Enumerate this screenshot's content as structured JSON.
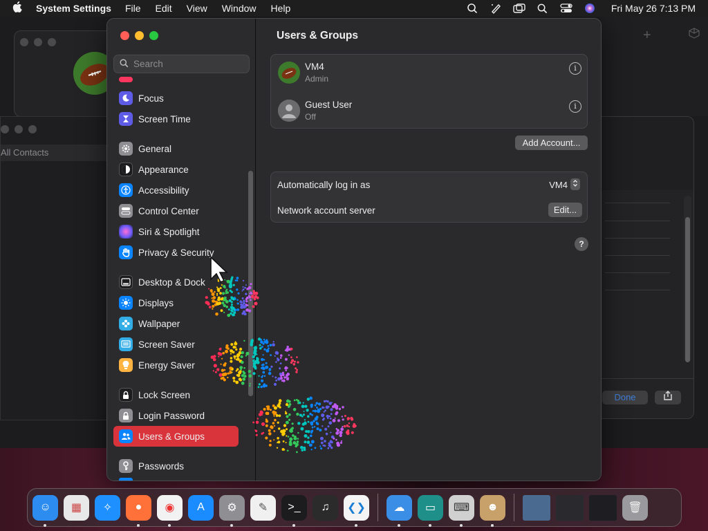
{
  "menubar": {
    "app_name": "System Settings",
    "menus": [
      "File",
      "Edit",
      "View",
      "Window",
      "Help"
    ],
    "clock": "Fri May 26  7:13 PM"
  },
  "bg_windows": {
    "contacts_label": "All Contacts",
    "done_label": "Done"
  },
  "sidebar": {
    "search_placeholder": "Search",
    "items": [
      {
        "label": "Focus",
        "icon": "moon-icon",
        "color": "#5e5ce6"
      },
      {
        "label": "Screen Time",
        "icon": "hourglass-icon",
        "color": "#5e5ce6"
      },
      {
        "label": "General",
        "icon": "gear-icon",
        "color": "#8e8e93"
      },
      {
        "label": "Appearance",
        "icon": "appearance-icon",
        "color": "#1c1c1e"
      },
      {
        "label": "Accessibility",
        "icon": "accessibility-icon",
        "color": "#0a84ff"
      },
      {
        "label": "Control Center",
        "icon": "control-center-icon",
        "color": "#8e8e93"
      },
      {
        "label": "Siri & Spotlight",
        "icon": "siri-icon",
        "color": "#bf5af2"
      },
      {
        "label": "Privacy & Security",
        "icon": "hand-icon",
        "color": "#0a84ff"
      },
      {
        "label": "Desktop & Dock",
        "icon": "dock-icon",
        "color": "#1c1c1e"
      },
      {
        "label": "Displays",
        "icon": "sun-icon",
        "color": "#0a84ff"
      },
      {
        "label": "Wallpaper",
        "icon": "flower-icon",
        "color": "#32ade6"
      },
      {
        "label": "Screen Saver",
        "icon": "screen-saver-icon",
        "color": "#32ade6"
      },
      {
        "label": "Energy Saver",
        "icon": "bulb-icon",
        "color": "#ffb340"
      },
      {
        "label": "Lock Screen",
        "icon": "lock-icon",
        "color": "#1c1c1e"
      },
      {
        "label": "Login Password",
        "icon": "lock-icon",
        "color": "#8e8e93"
      },
      {
        "label": "Users & Groups",
        "icon": "users-icon",
        "color": "#0a84ff"
      },
      {
        "label": "Passwords",
        "icon": "key-icon",
        "color": "#8e8e93"
      }
    ],
    "selected": "Users & Groups"
  },
  "content": {
    "title": "Users & Groups",
    "users": [
      {
        "name": "VM4",
        "role": "Admin"
      },
      {
        "name": "Guest User",
        "role": "Off"
      }
    ],
    "add_account_label": "Add Account...",
    "auto_login_label": "Automatically log in as",
    "auto_login_value": "VM4",
    "network_server_label": "Network account server",
    "edit_label": "Edit...",
    "help_label": "?"
  },
  "colors": {
    "accent_selected": "#d9343c",
    "window_bg": "#29292b"
  },
  "dock": {
    "apps": [
      {
        "name": "finder-icon",
        "color": "#2c8cf0",
        "running": true
      },
      {
        "name": "launchpad-icon",
        "color": "#e8e8e8",
        "running": false
      },
      {
        "name": "safari-icon",
        "color": "#1e90ff",
        "running": false
      },
      {
        "name": "firefox-icon",
        "color": "#ff7139",
        "running": true
      },
      {
        "name": "chrome-icon",
        "color": "#f2f2f2",
        "running": true
      },
      {
        "name": "app-store-icon",
        "color": "#1a8cff",
        "running": false
      },
      {
        "name": "system-settings-icon",
        "color": "#8e8e93",
        "running": true
      },
      {
        "name": "textedit-icon",
        "color": "#f0f0f0",
        "running": false
      },
      {
        "name": "terminal-icon",
        "color": "#1c1c1e",
        "running": true
      },
      {
        "name": "garageband-icon",
        "color": "#2b2b2b",
        "running": false
      },
      {
        "name": "vscode-icon",
        "color": "#f4f4f4",
        "running": true
      },
      {
        "name": "weather-icon",
        "color": "#3a8ee6",
        "running": true
      },
      {
        "name": "keynote-icon",
        "color": "#1f8f8a",
        "running": true
      },
      {
        "name": "keyboard-icon",
        "color": "#d0d0d0",
        "running": true
      },
      {
        "name": "contacts-icon",
        "color": "#c8a06a",
        "running": true
      },
      {
        "name": "window-thumb-1-icon",
        "color": "#4a6a90",
        "running": false
      },
      {
        "name": "window-thumb-2-icon",
        "color": "#2a2a2e",
        "running": false
      },
      {
        "name": "window-thumb-3-icon",
        "color": "#1e1e22",
        "running": false
      },
      {
        "name": "trash-icon",
        "color": "#9a9a9e",
        "running": false
      }
    ]
  }
}
